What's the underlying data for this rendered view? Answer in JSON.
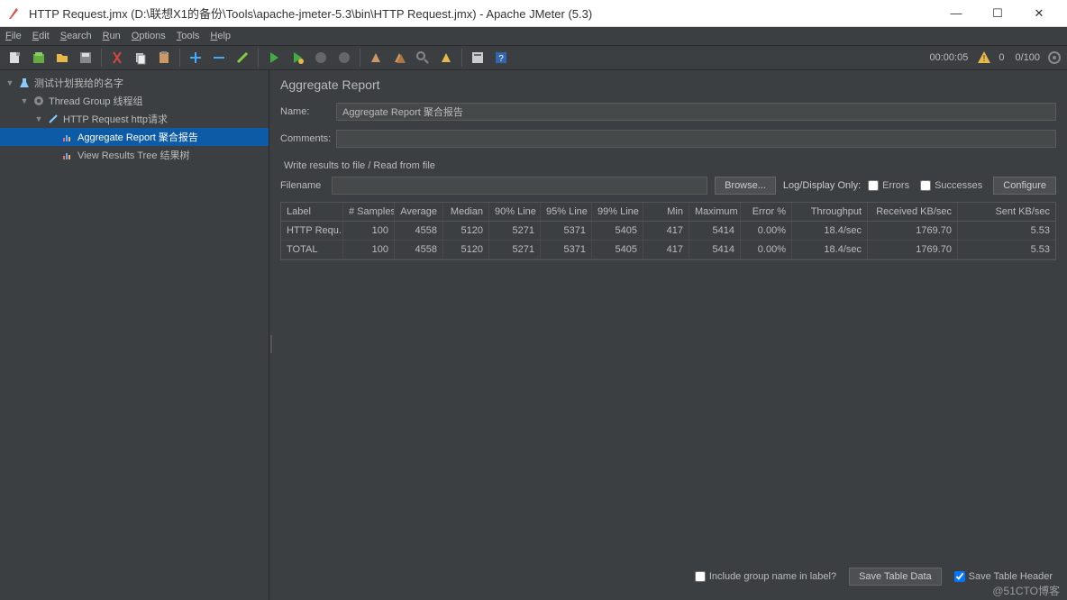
{
  "window": {
    "title": "HTTP Request.jmx (D:\\联想X1的备份\\Tools\\apache-jmeter-5.3\\bin\\HTTP Request.jmx) - Apache JMeter (5.3)"
  },
  "menubar": [
    "File",
    "Edit",
    "Search",
    "Run",
    "Options",
    "Tools",
    "Help"
  ],
  "status": {
    "time": "00:00:05",
    "warn_count": "0",
    "threads": "0/100"
  },
  "tree": {
    "root": "测试计划我给的名字",
    "group": "Thread Group  线程组",
    "request": "HTTP Request  http请求",
    "aggregate": "Aggregate Report  聚合报告",
    "results": "View Results Tree  结果树"
  },
  "panel": {
    "heading": "Aggregate Report",
    "name_label": "Name:",
    "name_value": "Aggregate Report 聚合报告",
    "comments_label": "Comments:",
    "comments_value": "",
    "fieldset": "Write results to file / Read from file",
    "filename_label": "Filename",
    "filename_value": "",
    "browse": "Browse...",
    "logdisplay": "Log/Display Only:",
    "errors": "Errors",
    "successes": "Successes",
    "configure": "Configure"
  },
  "table": {
    "headers": [
      "Label",
      "# Samples",
      "Average",
      "Median",
      "90% Line",
      "95% Line",
      "99% Line",
      "Min",
      "Maximum",
      "Error %",
      "Throughput",
      "Received KB/sec",
      "Sent KB/sec"
    ],
    "rows": [
      [
        "HTTP Requ...",
        "100",
        "4558",
        "5120",
        "5271",
        "5371",
        "5405",
        "417",
        "5414",
        "0.00%",
        "18.4/sec",
        "1769.70",
        "5.53"
      ],
      [
        "TOTAL",
        "100",
        "4558",
        "5120",
        "5271",
        "5371",
        "5405",
        "417",
        "5414",
        "0.00%",
        "18.4/sec",
        "1769.70",
        "5.53"
      ]
    ]
  },
  "footer": {
    "include_group": "Include group name in label?",
    "save_data": "Save Table Data",
    "save_header": "Save Table Header"
  },
  "watermark": "@51CTO博客"
}
